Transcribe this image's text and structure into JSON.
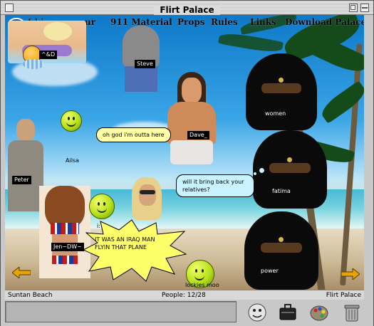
{
  "window": {
    "title": "Flirt Palace"
  },
  "room_menu": {
    "logo_fragment": "f l i",
    "items": [
      {
        "label": "ur"
      },
      {
        "label": "911 Material"
      },
      {
        "label": "Props"
      },
      {
        "label": "Rules"
      },
      {
        "label": "Links"
      },
      {
        "label": "Download Palace"
      }
    ]
  },
  "avatars": {
    "top_left_badge": "^&D",
    "steve": "Steve",
    "dave": "Dave_",
    "ailsa": "Ailsa",
    "peter": "Peter",
    "jen": "Jen~DW~",
    "partial": "i: n",
    "women": "women",
    "fatima": "fatima",
    "power": "power",
    "lockies": "lockies moo"
  },
  "speech": {
    "ailsa_bubble": "oh god i'm outta here",
    "fatima_thought": "will it bring back your relatives?",
    "jen_shout": "IT WAS AN IRAQ MAN FLYIN THAT PLANE"
  },
  "status": {
    "room_name": "Suntan Beach",
    "people": "People: 12/28",
    "server_name": "Flirt Palace"
  },
  "chat_input": {
    "value": ""
  },
  "icons": {
    "prev": "left-arrow-icon",
    "next": "right-arrow-icon",
    "face": "face-icon",
    "suitcase": "suitcase-icon",
    "palette": "palette-icon",
    "trash": "trash-icon"
  },
  "colors": {
    "sky": "#0d79c9",
    "bubble": "#ffffa8",
    "thought": "#c8f3ff",
    "accent_arrow": "#e8a400"
  }
}
